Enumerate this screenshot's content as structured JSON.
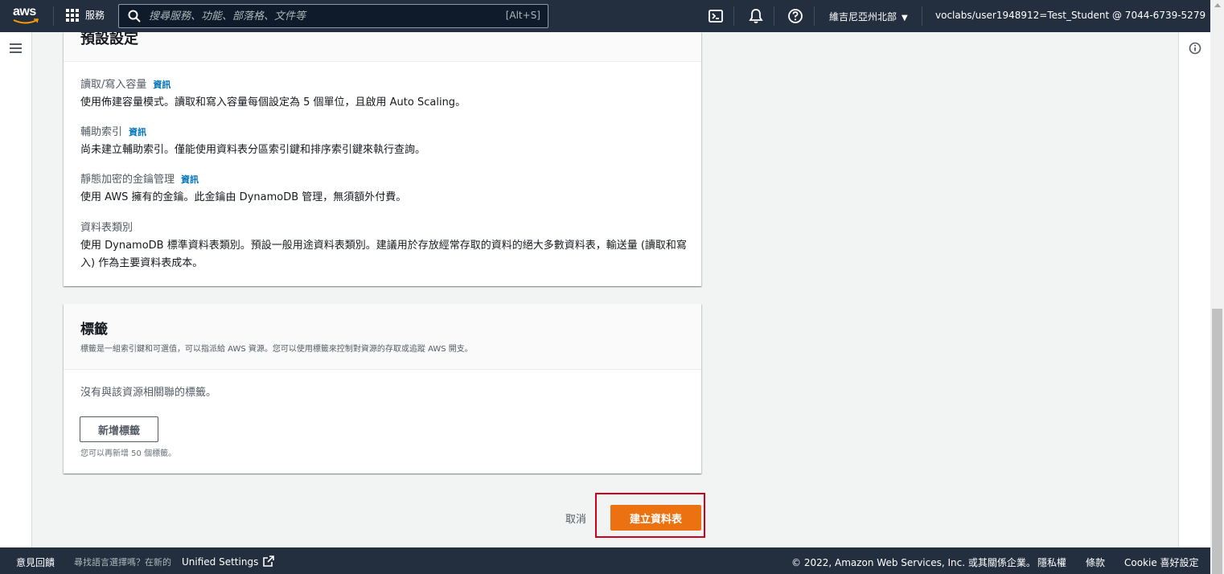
{
  "topnav": {
    "logo_text": "aws",
    "services_label": "服務",
    "search_placeholder": "搜尋服務、功能、部落格、文件等",
    "search_shortcut": "[Alt+S]",
    "region_label": "維吉尼亞州北部",
    "account_label": "voclabs/user1948912=Test_Student @ 7044-6739-5279"
  },
  "default_settings": {
    "heading": "預設設定",
    "info_link": "資訊",
    "items": [
      {
        "title": "讀取/寫入容量",
        "desc": "使用佈建容量模式。讀取和寫入容量每個設定為 5 個單位，且啟用 Auto Scaling。"
      },
      {
        "title": "輔助索引",
        "desc": "尚未建立輔助索引。僅能使用資料表分區索引鍵和排序索引鍵來執行查詢。"
      },
      {
        "title": "靜態加密的金鑰管理",
        "desc": "使用 AWS 擁有的金鑰。此金鑰由 DynamoDB 管理，無須額外付費。"
      },
      {
        "title": "資料表類別",
        "desc": "使用 DynamoDB 標準資料表類別。預設一般用途資料表類別。建議用於存放經常存取的資料的絕大多數資料表，輸送量 (讀取和寫入) 作為主要資料表成本。"
      }
    ]
  },
  "tags": {
    "heading": "標籤",
    "subtitle": "標籤是一組索引鍵和可選值，可以指派給 AWS 資源。您可以使用標籤來控制對資源的存取或追蹤 AWS 開支。",
    "empty_text": "沒有與該資源相關聯的標籤。",
    "add_button": "新增標籤",
    "limit_hint": "您可以再新增 50 個標籤。"
  },
  "actions": {
    "cancel": "取消",
    "create": "建立資料表"
  },
  "footer": {
    "feedback": "意見回饋",
    "lang_prompt": "尋找語言選擇嗎？在新的",
    "unified_settings": "Unified Settings",
    "copyright": "© 2022, Amazon Web Services, Inc. 或其關係企業。",
    "privacy": "隱私權",
    "terms": "條款",
    "cookie": "Cookie 喜好設定"
  },
  "colors": {
    "nav_bg": "#232f3e",
    "primary": "#ec7211",
    "link": "#0073bb",
    "highlight": "#d0021b"
  }
}
